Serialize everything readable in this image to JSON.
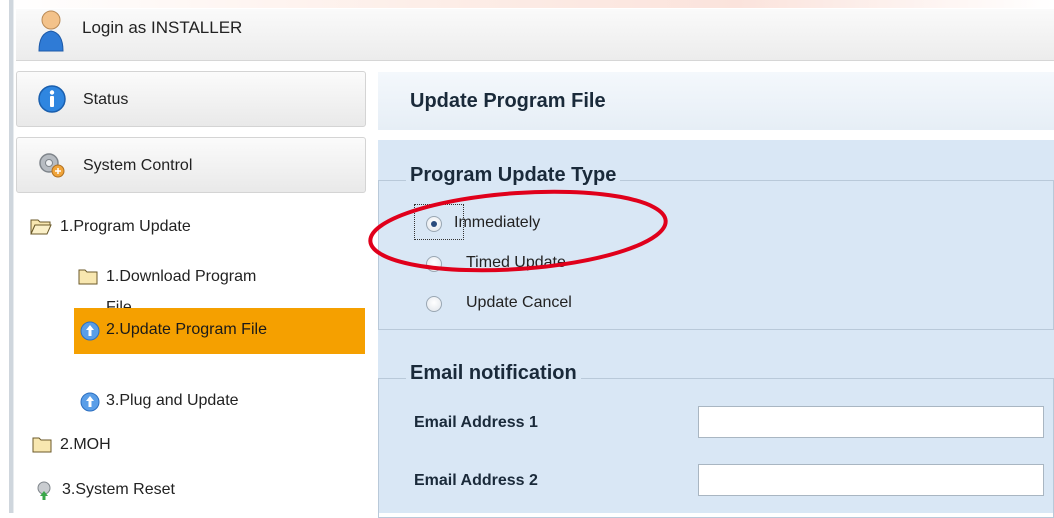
{
  "header": {
    "login_text": "Login as INSTALLER"
  },
  "sidebar": {
    "status_label": "Status",
    "system_control_label": "System Control",
    "tree": {
      "program_update": "1.Program Update",
      "download_program_file_line1": "1.Download Program",
      "download_program_file_line2": "File",
      "update_program_file": "2.Update Program File",
      "plug_and_update": "3.Plug and Update",
      "moh": "2.MOH",
      "system_reset": "3.System Reset"
    }
  },
  "main": {
    "title": "Update Program File",
    "program_update_type": {
      "legend": "Program Update Type",
      "options": [
        "Immediately",
        "Timed Update",
        "Update Cancel"
      ],
      "selected": "Immediately"
    },
    "email_notification": {
      "legend": "Email notification",
      "email1_label": "Email Address 1",
      "email2_label": "Email Address 2",
      "email1_value": "",
      "email2_value": ""
    }
  },
  "colors": {
    "selected_bg": "#f5a000",
    "panel_bg": "#d9e7f5",
    "annotation": "#e0001b"
  },
  "icons": [
    "user-icon",
    "info-icon",
    "gear-icon",
    "folder-open-icon",
    "folder-icon",
    "update-icon",
    "reset-icon"
  ]
}
